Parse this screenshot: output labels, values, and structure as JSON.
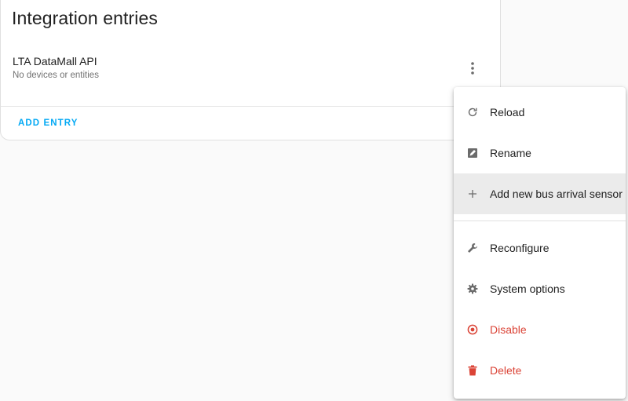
{
  "card": {
    "title": "Integration entries",
    "entry_name": "LTA DataMall API",
    "entry_subtitle": "No devices or entities",
    "add_entry_label": "ADD ENTRY"
  },
  "menu": {
    "items": [
      {
        "label": "Reload",
        "icon": "reload-icon"
      },
      {
        "label": "Rename",
        "icon": "rename-icon"
      },
      {
        "label": "Add new bus arrival sensor",
        "icon": "plus-icon"
      },
      {
        "label": "Reconfigure",
        "icon": "wrench-icon"
      },
      {
        "label": "System options",
        "icon": "gear-icon"
      },
      {
        "label": "Disable",
        "icon": "disable-icon"
      },
      {
        "label": "Delete",
        "icon": "trash-icon"
      }
    ]
  },
  "colors": {
    "accent": "#03a9f4",
    "danger": "#db4437",
    "hover_bg": "#ebebeb"
  }
}
